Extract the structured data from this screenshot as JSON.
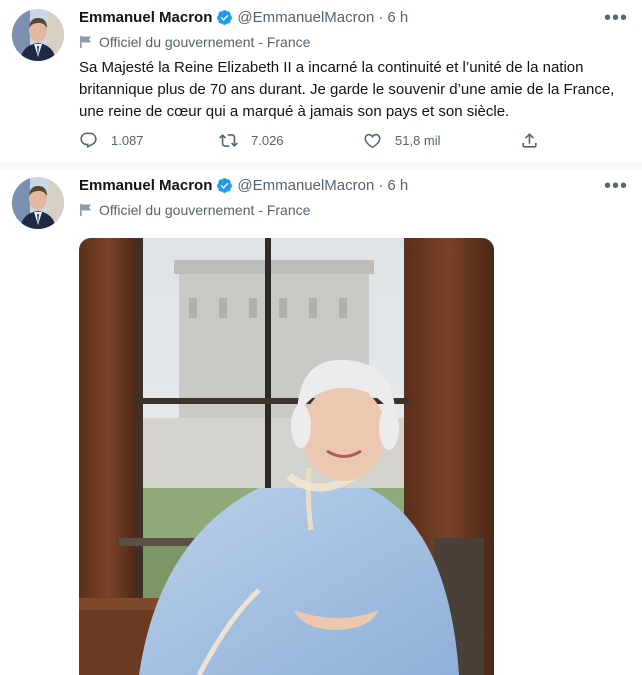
{
  "tweets": [
    {
      "author": {
        "name": "Emmanuel Macron",
        "handle": "@EmmanuelMacron",
        "time": "6 h"
      },
      "label": "Officiel du gouvernement - France",
      "text": "Sa Majesté la Reine Elizabeth II a incarné la continuité et l’unité de la nation britannique plus de 70 ans durant. Je garde le souvenir d’une amie de la France, une reine de cœur qui a marqué à jamais son pays et son siècle.",
      "stats": {
        "replies": "1.087",
        "retweets": "7.026",
        "likes": "51,8 mil"
      },
      "more": "•••"
    },
    {
      "author": {
        "name": "Emmanuel Macron",
        "handle": "@EmmanuelMacron",
        "time": "6 h"
      },
      "label": "Officiel du gouvernement - France",
      "more": "•••"
    }
  ],
  "separator_dot": "·",
  "colors": {
    "text": "#0f1419",
    "secondary": "#536471",
    "verified": "#1d9bf0",
    "separator": "#f7f9f9"
  },
  "icons": [
    "verified-badge-icon",
    "government-flag-icon",
    "reply-icon",
    "retweet-icon",
    "like-icon",
    "share-icon",
    "more-icon"
  ]
}
